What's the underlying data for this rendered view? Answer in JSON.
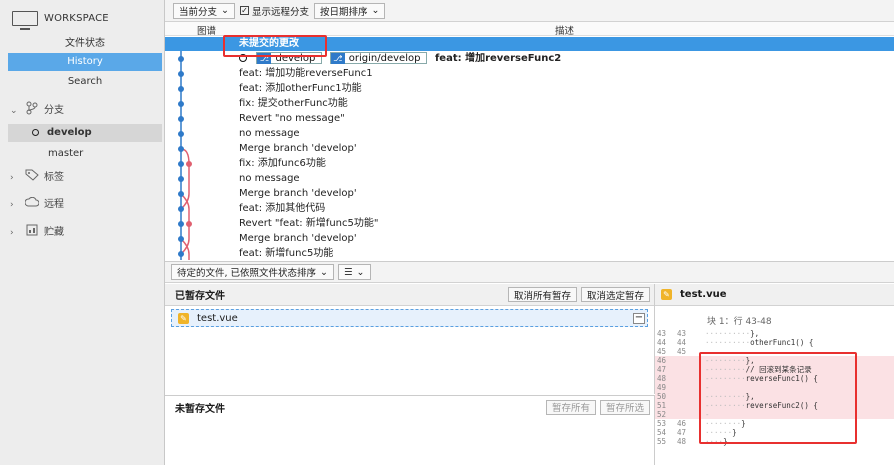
{
  "sidebar": {
    "workspace": "WORKSPACE",
    "nav": [
      "文件状态",
      "History",
      "Search"
    ],
    "branches_label": "分支",
    "branches": [
      "develop",
      "master"
    ],
    "tags_label": "标签",
    "remotes_label": "远程",
    "stash_label": "贮藏"
  },
  "toolbar": {
    "branch_select": "当前分支",
    "show_remote": "显示远程分支",
    "sort": "按日期排序"
  },
  "columns": {
    "graph": "图谱",
    "desc": "描述"
  },
  "commits": [
    "未提交的更改",
    "feat: 增加reverseFunc2",
    "feat: 增加功能reverseFunc1",
    "feat: 添加otherFunc1功能",
    "fix: 提交otherFunc功能",
    "Revert \"no message\"",
    "no message",
    "Merge branch 'develop'",
    "fix: 添加func6功能",
    "no message",
    "Merge branch 'develop'",
    "feat: 添加其他代码",
    "Revert \"feat: 新增func5功能\"",
    "Merge branch 'develop'",
    "feat: 新增func5功能"
  ],
  "head_tags": [
    "develop",
    "origin/develop"
  ],
  "files_toolbar": {
    "sort": "待定的文件, 已依照文件状态排序"
  },
  "staged": {
    "title": "已暂存文件",
    "unstage_all": "取消所有暂存",
    "unstage_selected": "取消选定暂存",
    "file": "test.vue"
  },
  "unstaged": {
    "title": "未暂存文件",
    "stage_all": "暂存所有",
    "stage_selected": "暂存所选"
  },
  "diff": {
    "file": "test.vue",
    "hunk": "块 1：行 43-48",
    "lines": [
      {
        "o": "43",
        "n": "43",
        "t": "},",
        "del": false,
        "ind": 10
      },
      {
        "o": "44",
        "n": "44",
        "t": "otherFunc1() {",
        "del": false,
        "ind": 10
      },
      {
        "o": "45",
        "n": "45",
        "t": "",
        "del": false,
        "ind": 0
      },
      {
        "o": "46",
        "n": "",
        "t": "},",
        "del": true,
        "ind": 8
      },
      {
        "o": "47",
        "n": "",
        "t": "// 回滚到某条记录",
        "del": true,
        "ind": 8
      },
      {
        "o": "48",
        "n": "",
        "t": "reverseFunc1() {",
        "del": true,
        "ind": 8
      },
      {
        "o": "49",
        "n": "",
        "t": "",
        "del": true,
        "ind": 0
      },
      {
        "o": "50",
        "n": "",
        "t": "},",
        "del": true,
        "ind": 8
      },
      {
        "o": "51",
        "n": "",
        "t": "reverseFunc2() {",
        "del": true,
        "ind": 8
      },
      {
        "o": "52",
        "n": "",
        "t": "",
        "del": true,
        "ind": 0
      },
      {
        "o": "53",
        "n": "46",
        "t": "}",
        "del": false,
        "ind": 8
      },
      {
        "o": "54",
        "n": "47",
        "t": "}",
        "del": false,
        "ind": 6
      },
      {
        "o": "55",
        "n": "48",
        "t": "}",
        "del": false,
        "ind": 4
      }
    ]
  },
  "colors": {
    "accent": "#3b97e3",
    "merge_line": "#e06070",
    "graph_line": "#2f7ac9",
    "highlight": "#e8302f"
  }
}
